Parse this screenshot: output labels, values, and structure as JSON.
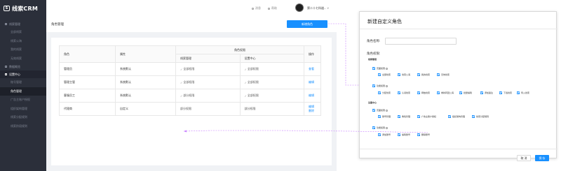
{
  "app": {
    "logo_text": "线索CRM"
  },
  "sidebar": {
    "group1": {
      "label": "线索管理",
      "items": [
        "全部线索",
        "线索公海",
        "我的线索",
        "无效线索"
      ]
    },
    "group2": {
      "label": "数据概览"
    },
    "group3": {
      "label": "设置中心",
      "items": [
        "账号管理",
        "角色管理",
        "广告主账户授权",
        "组织架构管理",
        "线索分配规则",
        "线索阶段规则"
      ],
      "selected_index": 1
    }
  },
  "topbar": {
    "messages": "消息",
    "help": "帮助",
    "username": "第二十七科道..."
  },
  "page": {
    "title": "角色管理",
    "new_role_button": "新增角色"
  },
  "table": {
    "headers": {
      "role": "角色",
      "attribute": "属性",
      "permission_group": "角色权限",
      "lead_mgmt": "线索管理",
      "settings": "设置中心",
      "actions": "操作"
    },
    "rows": [
      {
        "role": "管理员",
        "attribute": "系统默认",
        "lead": "全部权限",
        "settings": "全部权限",
        "actions": [
          "查看"
        ]
      },
      {
        "role": "管理主管",
        "attribute": "系统默认",
        "lead": "全部权限",
        "settings": "全部权限",
        "actions": [
          "编辑"
        ]
      },
      {
        "role": "客服员工",
        "attribute": "系统默认",
        "lead": "部分权限",
        "settings": "全部权限",
        "actions": [
          "编辑"
        ]
      },
      {
        "role": "代理商",
        "attribute": "自定义",
        "lead": "部分权限",
        "settings": "部分权限",
        "actions": [
          "编辑",
          "删除"
        ]
      }
    ]
  },
  "modal": {
    "title": "新建自定义角色",
    "name_label": "角色名称:",
    "name_value": "",
    "name_placeholder": "",
    "perms_label": "角色权限:",
    "sections": [
      {
        "label": "线索管理",
        "groups": [
          {
            "label": "页面权限",
            "items": [
              "全部线索",
              "线索公海",
              "我的线索",
              "无效线索"
            ]
          },
          {
            "label": "功能权限",
            "items": [
              "分配线索",
              "认领线索",
              "释放线索",
              "重新转回公海",
              "批量编辑",
              "添加备注",
              "下载线索",
              "导入线索"
            ]
          }
        ]
      },
      {
        "label": "设置中心",
        "groups": [
          {
            "label": "页面权限",
            "items": [
              "账号管理",
              "角色管理",
              "广告主账户授权",
              "组织架构管理",
              "线索分配规则"
            ]
          },
          {
            "label": "功能权限",
            "items": [
              "添加账号",
              "编辑账号",
              "删除账号"
            ]
          }
        ]
      }
    ],
    "cancel": "取 消",
    "ok": "保 存"
  },
  "colors": {
    "primary": "#1890ff",
    "sidebar_bg": "#2b2f3a",
    "connector": "#c77dff"
  }
}
